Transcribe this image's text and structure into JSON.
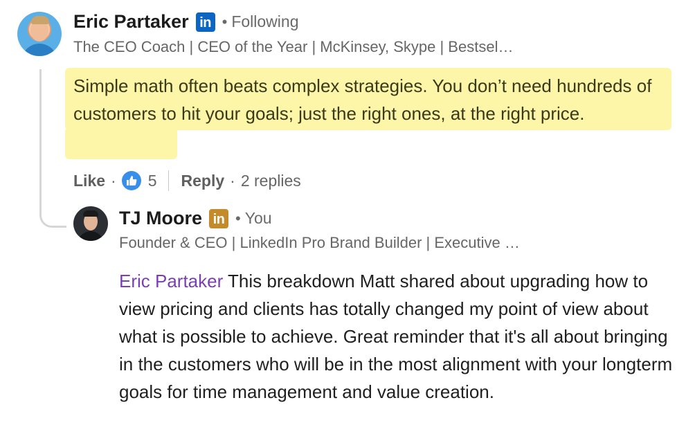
{
  "comment": {
    "author": {
      "name": "Eric Partaker",
      "relation": "Following",
      "headline": "The CEO Coach | CEO of the Year | McKinsey, Skype | Bestsel…",
      "badge": "in"
    },
    "text": "Simple math often beats complex strategies. You don’t need hundreds of customers to hit your goals; just the right ones, at the right price.",
    "actions": {
      "like_label": "Like",
      "like_count": "5",
      "reply_label": "Reply",
      "replies_label": "2 replies"
    }
  },
  "reply": {
    "author": {
      "name": "TJ Moore",
      "relation": "You",
      "headline": "Founder & CEO | LinkedIn Pro Brand Builder | Executive …",
      "badge": "in"
    },
    "mention": "Eric Partaker",
    "text": " This breakdown Matt shared about upgrading how to view pricing and clients has totally changed my point of view about what is possible to achieve. Great reminder that it's all about bringing in the customers who will be in the most alignment with your longterm goals for time management and value creation."
  },
  "colors": {
    "highlight": "#fdf6a8",
    "linkedin_blue": "#0a66c2",
    "premium_gold": "#c38b2a",
    "mention": "#7b3fb5",
    "like_blue": "#378fe9"
  },
  "icons": {
    "linkedin_badge": "linkedin-icon",
    "premium_badge": "linkedin-premium-icon",
    "like_reaction": "thumbs-up-icon"
  }
}
